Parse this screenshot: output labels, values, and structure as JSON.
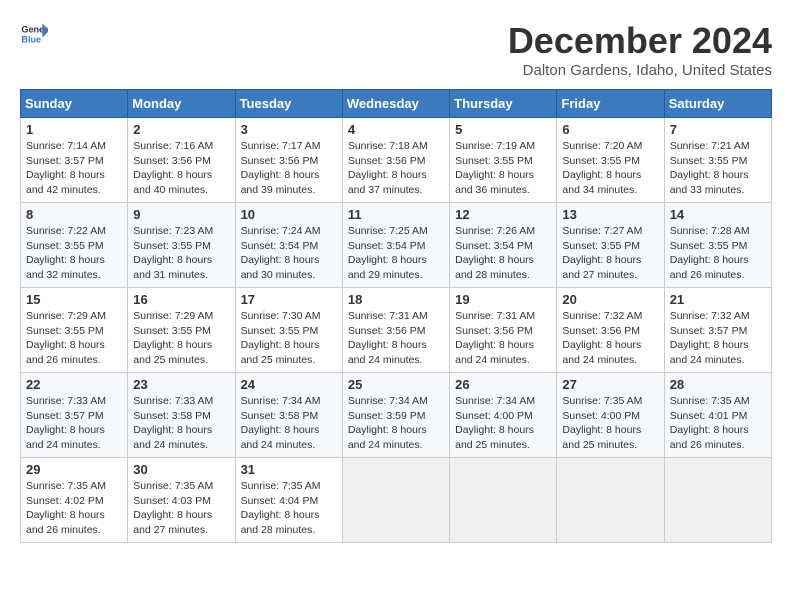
{
  "logo": {
    "general": "General",
    "blue": "Blue"
  },
  "header": {
    "month": "December 2024",
    "location": "Dalton Gardens, Idaho, United States"
  },
  "weekdays": [
    "Sunday",
    "Monday",
    "Tuesday",
    "Wednesday",
    "Thursday",
    "Friday",
    "Saturday"
  ],
  "weeks": [
    [
      {
        "day": "1",
        "sunrise": "7:14 AM",
        "sunset": "3:57 PM",
        "daylight": "8 hours and 42 minutes."
      },
      {
        "day": "2",
        "sunrise": "7:16 AM",
        "sunset": "3:56 PM",
        "daylight": "8 hours and 40 minutes."
      },
      {
        "day": "3",
        "sunrise": "7:17 AM",
        "sunset": "3:56 PM",
        "daylight": "8 hours and 39 minutes."
      },
      {
        "day": "4",
        "sunrise": "7:18 AM",
        "sunset": "3:56 PM",
        "daylight": "8 hours and 37 minutes."
      },
      {
        "day": "5",
        "sunrise": "7:19 AM",
        "sunset": "3:55 PM",
        "daylight": "8 hours and 36 minutes."
      },
      {
        "day": "6",
        "sunrise": "7:20 AM",
        "sunset": "3:55 PM",
        "daylight": "8 hours and 34 minutes."
      },
      {
        "day": "7",
        "sunrise": "7:21 AM",
        "sunset": "3:55 PM",
        "daylight": "8 hours and 33 minutes."
      }
    ],
    [
      {
        "day": "8",
        "sunrise": "7:22 AM",
        "sunset": "3:55 PM",
        "daylight": "8 hours and 32 minutes."
      },
      {
        "day": "9",
        "sunrise": "7:23 AM",
        "sunset": "3:55 PM",
        "daylight": "8 hours and 31 minutes."
      },
      {
        "day": "10",
        "sunrise": "7:24 AM",
        "sunset": "3:54 PM",
        "daylight": "8 hours and 30 minutes."
      },
      {
        "day": "11",
        "sunrise": "7:25 AM",
        "sunset": "3:54 PM",
        "daylight": "8 hours and 29 minutes."
      },
      {
        "day": "12",
        "sunrise": "7:26 AM",
        "sunset": "3:54 PM",
        "daylight": "8 hours and 28 minutes."
      },
      {
        "day": "13",
        "sunrise": "7:27 AM",
        "sunset": "3:55 PM",
        "daylight": "8 hours and 27 minutes."
      },
      {
        "day": "14",
        "sunrise": "7:28 AM",
        "sunset": "3:55 PM",
        "daylight": "8 hours and 26 minutes."
      }
    ],
    [
      {
        "day": "15",
        "sunrise": "7:29 AM",
        "sunset": "3:55 PM",
        "daylight": "8 hours and 26 minutes."
      },
      {
        "day": "16",
        "sunrise": "7:29 AM",
        "sunset": "3:55 PM",
        "daylight": "8 hours and 25 minutes."
      },
      {
        "day": "17",
        "sunrise": "7:30 AM",
        "sunset": "3:55 PM",
        "daylight": "8 hours and 25 minutes."
      },
      {
        "day": "18",
        "sunrise": "7:31 AM",
        "sunset": "3:56 PM",
        "daylight": "8 hours and 24 minutes."
      },
      {
        "day": "19",
        "sunrise": "7:31 AM",
        "sunset": "3:56 PM",
        "daylight": "8 hours and 24 minutes."
      },
      {
        "day": "20",
        "sunrise": "7:32 AM",
        "sunset": "3:56 PM",
        "daylight": "8 hours and 24 minutes."
      },
      {
        "day": "21",
        "sunrise": "7:32 AM",
        "sunset": "3:57 PM",
        "daylight": "8 hours and 24 minutes."
      }
    ],
    [
      {
        "day": "22",
        "sunrise": "7:33 AM",
        "sunset": "3:57 PM",
        "daylight": "8 hours and 24 minutes."
      },
      {
        "day": "23",
        "sunrise": "7:33 AM",
        "sunset": "3:58 PM",
        "daylight": "8 hours and 24 minutes."
      },
      {
        "day": "24",
        "sunrise": "7:34 AM",
        "sunset": "3:58 PM",
        "daylight": "8 hours and 24 minutes."
      },
      {
        "day": "25",
        "sunrise": "7:34 AM",
        "sunset": "3:59 PM",
        "daylight": "8 hours and 24 minutes."
      },
      {
        "day": "26",
        "sunrise": "7:34 AM",
        "sunset": "4:00 PM",
        "daylight": "8 hours and 25 minutes."
      },
      {
        "day": "27",
        "sunrise": "7:35 AM",
        "sunset": "4:00 PM",
        "daylight": "8 hours and 25 minutes."
      },
      {
        "day": "28",
        "sunrise": "7:35 AM",
        "sunset": "4:01 PM",
        "daylight": "8 hours and 26 minutes."
      }
    ],
    [
      {
        "day": "29",
        "sunrise": "7:35 AM",
        "sunset": "4:02 PM",
        "daylight": "8 hours and 26 minutes."
      },
      {
        "day": "30",
        "sunrise": "7:35 AM",
        "sunset": "4:03 PM",
        "daylight": "8 hours and 27 minutes."
      },
      {
        "day": "31",
        "sunrise": "7:35 AM",
        "sunset": "4:04 PM",
        "daylight": "8 hours and 28 minutes."
      },
      null,
      null,
      null,
      null
    ]
  ],
  "labels": {
    "sunrise": "Sunrise:",
    "sunset": "Sunset:",
    "daylight": "Daylight:"
  }
}
